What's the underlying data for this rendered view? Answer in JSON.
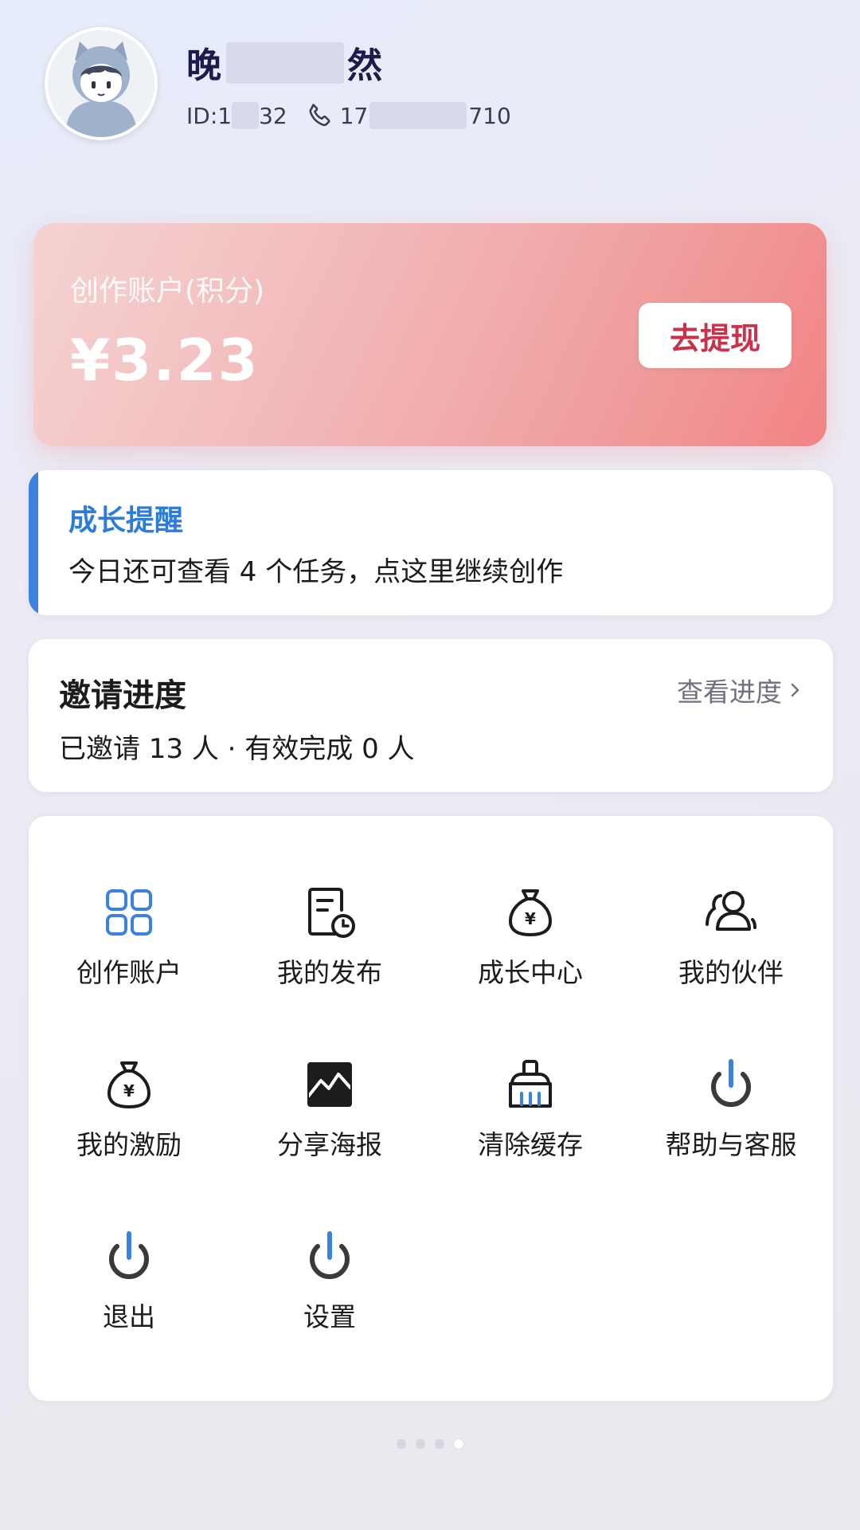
{
  "profile": {
    "name_start": "晚",
    "name_end": "然",
    "id_prefix": "ID:1",
    "id_suffix": "32",
    "phone_prefix": "17",
    "phone_suffix": "710",
    "avatar_icon": "cartoon-cat-avatar-icon"
  },
  "account": {
    "label": "创作账户(积分)",
    "amount": "¥3.23",
    "withdraw_label": "去提现"
  },
  "reminder": {
    "title": "成长提醒",
    "text": "今日还可查看 4 个任务，点这里继续创作"
  },
  "invite": {
    "title": "邀请进度",
    "link_label": "查看进度",
    "text": "已邀请 13 人 · 有效完成 0 人"
  },
  "menu": {
    "items": [
      {
        "label": "创作账户",
        "icon": "grid-icon"
      },
      {
        "label": "我的发布",
        "icon": "document-clock-icon"
      },
      {
        "label": "成长中心",
        "icon": "money-bag-icon"
      },
      {
        "label": "我的伙伴",
        "icon": "users-icon"
      },
      {
        "label": "我的激励",
        "icon": "money-bag-icon"
      },
      {
        "label": "分享海报",
        "icon": "image-icon"
      },
      {
        "label": "清除缓存",
        "icon": "broom-icon"
      },
      {
        "label": "帮助与客服",
        "icon": "power-icon"
      },
      {
        "label": "退出",
        "icon": "power-icon"
      },
      {
        "label": "设置",
        "icon": "power-icon"
      }
    ]
  },
  "colors": {
    "accent_blue": "#3b82e0",
    "withdraw_red": "#c8324a",
    "card_gradient_end": "#f28385"
  },
  "pagination": {
    "total": 4,
    "active_index": 3
  }
}
